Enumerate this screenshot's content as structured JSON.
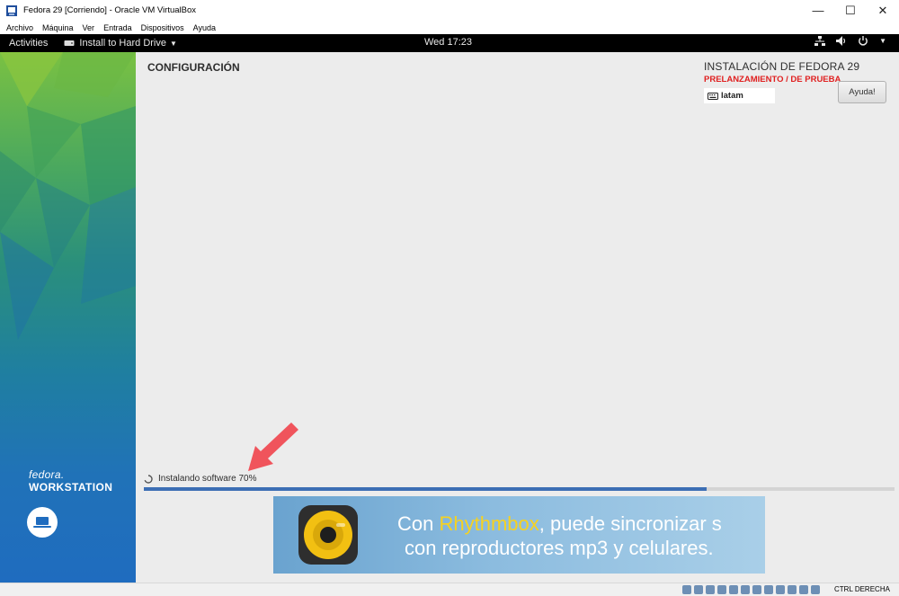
{
  "window": {
    "title": "Fedora 29 [Corriendo] - Oracle VM VirtualBox",
    "controls": {
      "minimize": "—",
      "maximize": "☐",
      "close": "✕"
    }
  },
  "vbox_menu": [
    "Archivo",
    "Máquina",
    "Ver",
    "Entrada",
    "Dispositivos",
    "Ayuda"
  ],
  "gnome_bar": {
    "activities": "Activities",
    "app_menu": "Install to Hard Drive",
    "clock": "Wed 17:23",
    "icons": [
      "network-icon",
      "volume-icon",
      "power-icon"
    ]
  },
  "installer": {
    "spoke_title": "CONFIGURACIÓN",
    "product_title": "INSTALACIÓN DE FEDORA 29",
    "prerelease": "PRELANZAMIENTO / DE PRUEBA",
    "keyboard_layout": "latam",
    "help_label": "Ayuda!",
    "brand": {
      "fedora": "fedora.",
      "edition": "WORKSTATION"
    },
    "progress": {
      "label": "Instalando software 70%",
      "fraction": 0.75
    },
    "banner": {
      "line1_prefix": "Con ",
      "line1_highlight": "Rhythmbox",
      "line1_suffix": ", puede sincronizar s",
      "line2": "con reproductores mp3 y celulares."
    }
  },
  "status_bar": {
    "host_key": "CTRL DERECHA"
  },
  "colors": {
    "accent": "#3c6eb4",
    "prerelease": "#e02020",
    "arrow": "#f0545c",
    "highlight": "#f7d21f"
  }
}
